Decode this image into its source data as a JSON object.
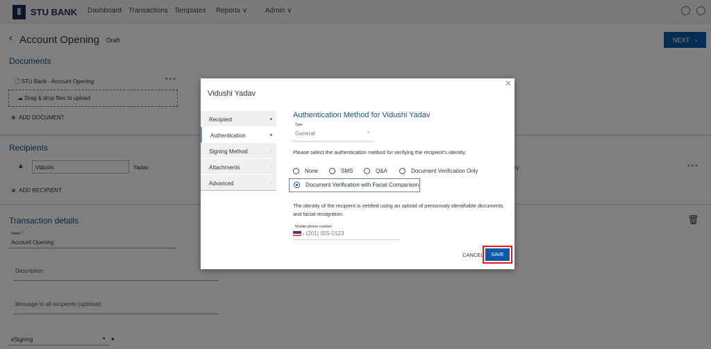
{
  "header": {
    "brand": "STU BANK",
    "nav": [
      "Dashboard",
      "Transactions",
      "Templates",
      "Reports",
      "Admin"
    ]
  },
  "page": {
    "title": "Account Opening",
    "status": "Draft",
    "next_label": "NEXT"
  },
  "documents": {
    "heading": "Documents",
    "file": "STU Bank - Account Opening",
    "dropzone": "Drag & drop files to upload",
    "add": "ADD DOCUMENT"
  },
  "recipients": {
    "heading": "Recipients",
    "first": "Vidushi",
    "last": "Yadav",
    "partial": "ry",
    "add": "ADD RECIPIENT"
  },
  "details": {
    "heading": "Transaction details",
    "name_label": "Name *",
    "name_value": "Account Opening",
    "description": "Description",
    "message": "Message to all recipients (optional)",
    "signing": "eSigning"
  },
  "modal": {
    "title": "Vidushi Yadav",
    "nav": [
      {
        "label": "Recipient",
        "done": true
      },
      {
        "label": "Authentication",
        "done": true
      },
      {
        "label": "Signing Method",
        "done": false
      },
      {
        "label": "Attachments",
        "done": false
      },
      {
        "label": "Advanced",
        "done": false
      }
    ],
    "heading": "Authentication Method for Vidushi Yadav",
    "type_label": "Type",
    "type_value": "General",
    "instruction": "Please select the authentication method for verifying the recipient's identity.",
    "options": [
      "None",
      "SMS",
      "Q&A",
      "Document Verification Only",
      "Document Verification with Facial Comparison"
    ],
    "selected": "Document Verification with Facial Comparison",
    "description": "The identity of the recipient is verified using an upload of personnaly identifiable documents and facial recognition.",
    "phone_label": "Mobile phone number",
    "phone_value": "(201) 555-0123",
    "cancel": "CANCEL",
    "save": "SAVE"
  },
  "colors": {
    "primary": "#0b5aa6",
    "heading": "#1f4e79",
    "highlight": "#e8141c"
  }
}
